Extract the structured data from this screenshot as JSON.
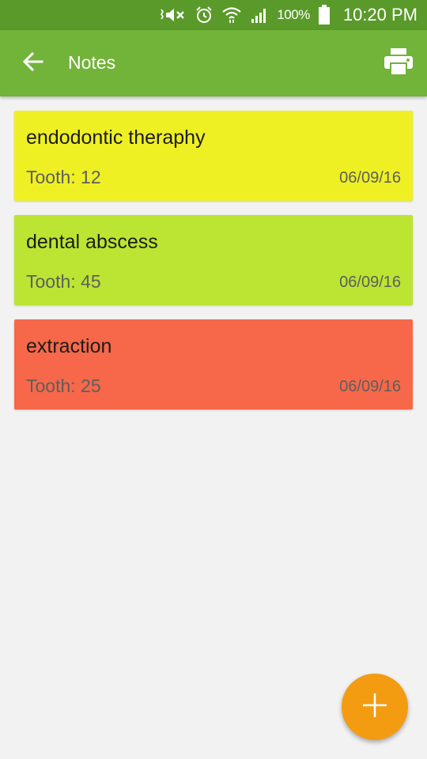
{
  "status_bar": {
    "battery_percent": "100%",
    "time": "10:20 PM",
    "icons": [
      "mute-icon",
      "alarm-icon",
      "wifi-icon",
      "signal-icon",
      "battery-icon"
    ]
  },
  "app_bar": {
    "title": "Notes",
    "back_icon": "arrow-back-icon",
    "print_icon": "print-icon"
  },
  "notes": [
    {
      "title": "endodontic theraphy",
      "tooth": "Tooth: 12",
      "date": "06/09/16",
      "color": "#eef024"
    },
    {
      "title": "dental abscess",
      "tooth": "Tooth: 45",
      "date": "06/09/16",
      "color": "#bbe532"
    },
    {
      "title": "extraction",
      "tooth": "Tooth: 25",
      "date": "06/09/16",
      "color": "#f66849"
    }
  ],
  "fab": {
    "icon": "add-icon",
    "color": "#f39c12"
  },
  "colors": {
    "status_bar": "#5a9a2a",
    "app_bar": "#72b339",
    "background": "#f2f2f2"
  }
}
